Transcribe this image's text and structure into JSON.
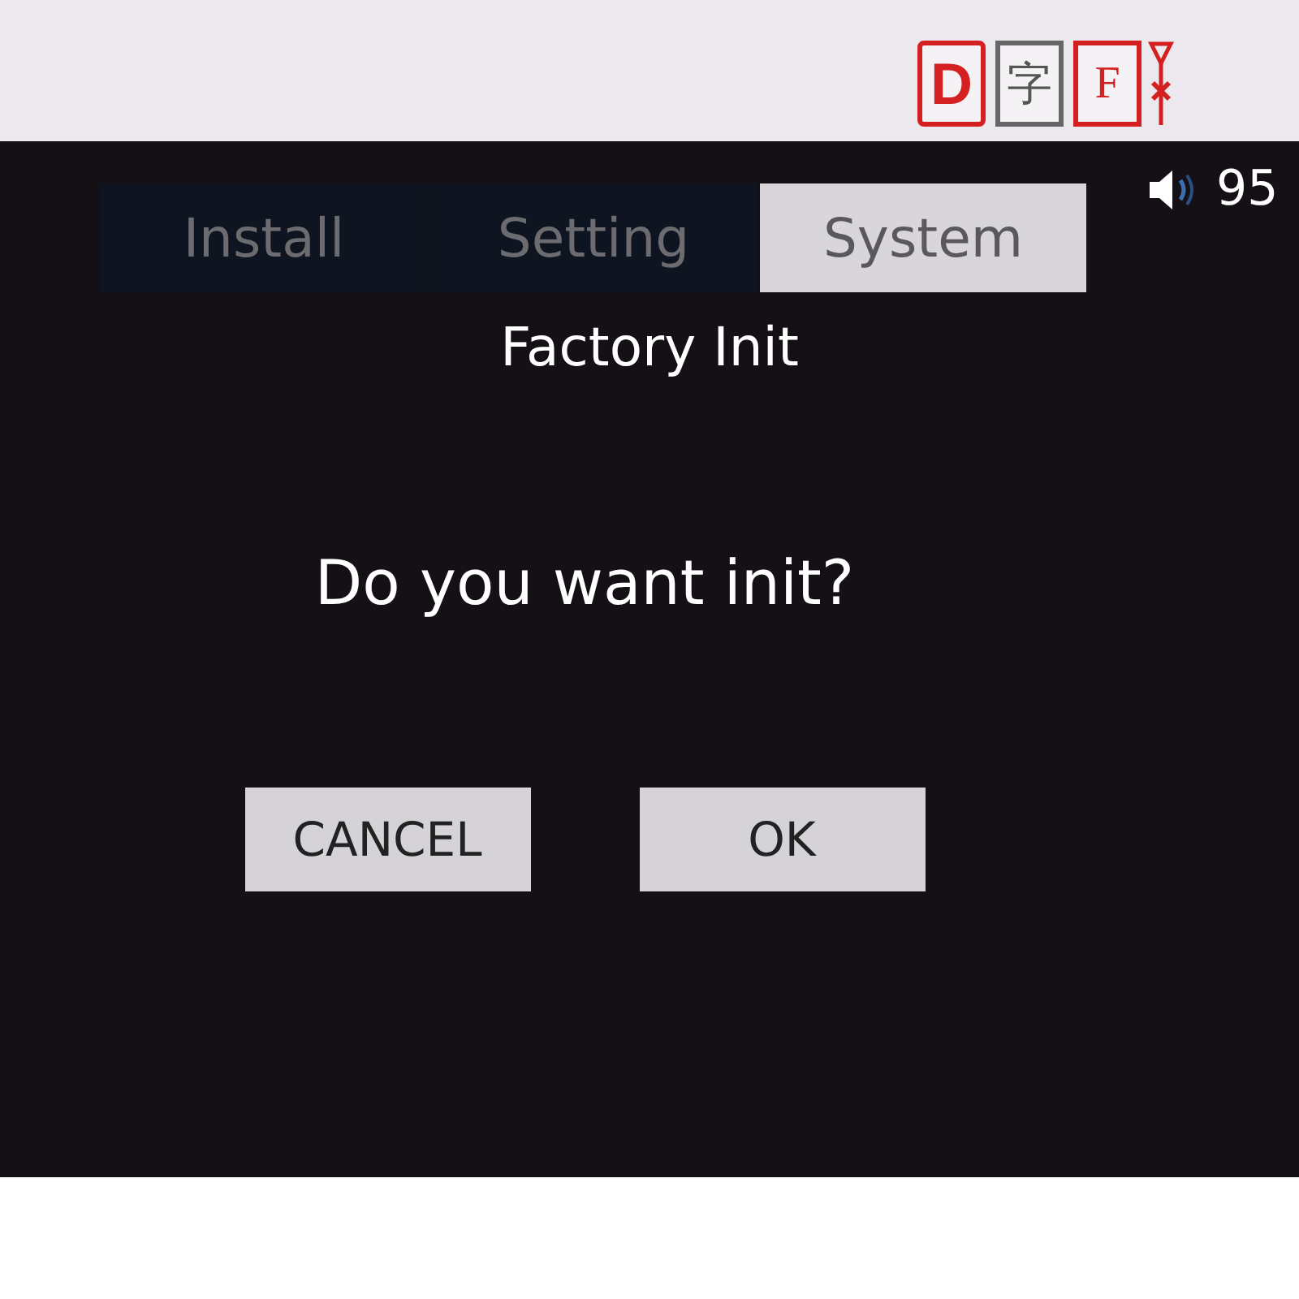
{
  "top_bar": {
    "buttons": [
      {
        "label": "D",
        "kind": "bold"
      },
      {
        "label": "字",
        "kind": "plain"
      },
      {
        "label": "F",
        "kind": "serif"
      }
    ]
  },
  "volume": {
    "value": "95"
  },
  "tabs": [
    {
      "label": "Install",
      "selected": false
    },
    {
      "label": "Setting",
      "selected": false
    },
    {
      "label": "System",
      "selected": true
    }
  ],
  "dialog": {
    "title": "Factory Init",
    "message": "Do you want init?",
    "buttons": [
      "CANCEL",
      "OK"
    ]
  }
}
